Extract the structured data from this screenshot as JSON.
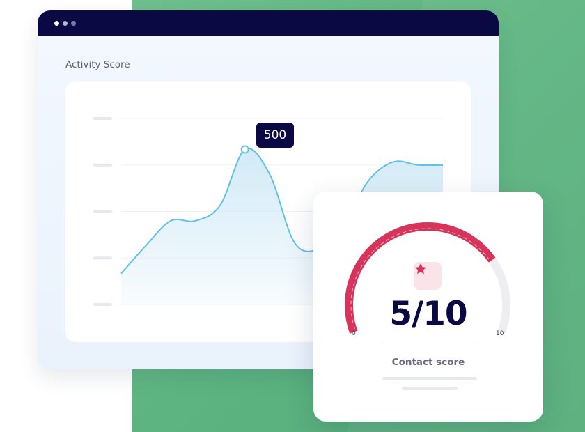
{
  "window": {
    "title": "Activity Score",
    "controls": [
      "close-dot",
      "minimize-dot",
      "maximize-dot"
    ]
  },
  "chart": {
    "tooltip_value": "500",
    "colors": {
      "line": "#62c0e6",
      "fill": "#cfe9f6",
      "marker": "#62c0e6"
    }
  },
  "chart_data": {
    "type": "area",
    "title": "Activity Score",
    "xlabel": "",
    "ylabel": "",
    "ytick_labels": [
      "",
      "",
      "",
      "",
      ""
    ],
    "grid": true,
    "ylim": [
      0,
      600
    ],
    "x": [
      0,
      1,
      2,
      3,
      4,
      5,
      6,
      7,
      8,
      9,
      10,
      11,
      12,
      13
    ],
    "series": [
      {
        "values": [
          100,
          190,
          270,
          270,
          320,
          500,
          420,
          200,
          180,
          260,
          400,
          460,
          450,
          450
        ]
      }
    ],
    "highlight": {
      "index": 5,
      "value": 500
    }
  },
  "score_card": {
    "value": "5/10",
    "label": "Contact score",
    "min_label": "0",
    "max_label": "10",
    "score_fraction": 0.5,
    "icon": "star-icon",
    "colors": {
      "active": "#d6345a",
      "track": "#eeeef1",
      "badge_bg": "#fbe3ea"
    }
  }
}
